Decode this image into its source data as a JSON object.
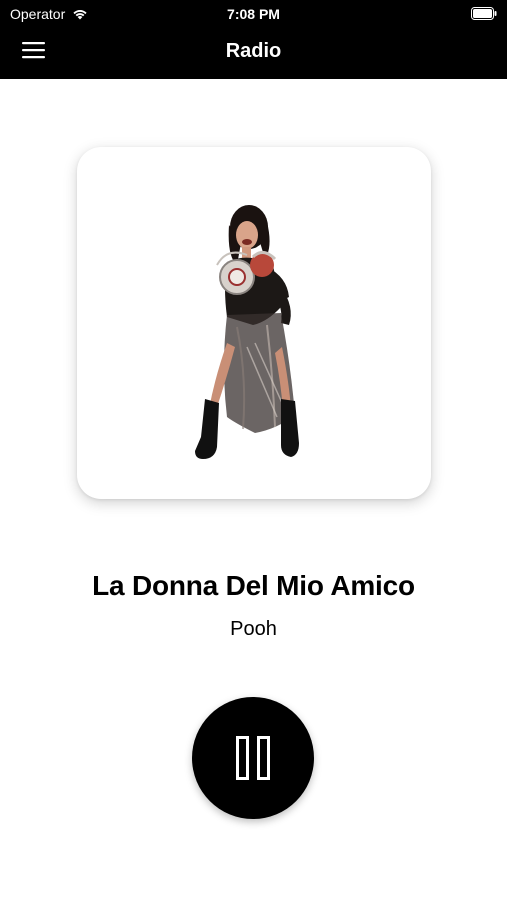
{
  "status_bar": {
    "carrier": "Operator",
    "time": "7:08 PM",
    "wifi_icon": "wifi-icon",
    "battery_icon": "battery-icon"
  },
  "nav": {
    "menu_icon": "hamburger-menu-icon",
    "title": "Radio"
  },
  "now_playing": {
    "artwork": "album-artwork-image",
    "title": "La Donna Del Mio Amico",
    "artist": "Pooh"
  },
  "controls": {
    "play_pause_icon": "pause-icon",
    "state": "playing"
  },
  "colors": {
    "bar_background": "#000000",
    "bar_text": "#ffffff",
    "page_background": "#ffffff",
    "button_background": "#000000"
  }
}
